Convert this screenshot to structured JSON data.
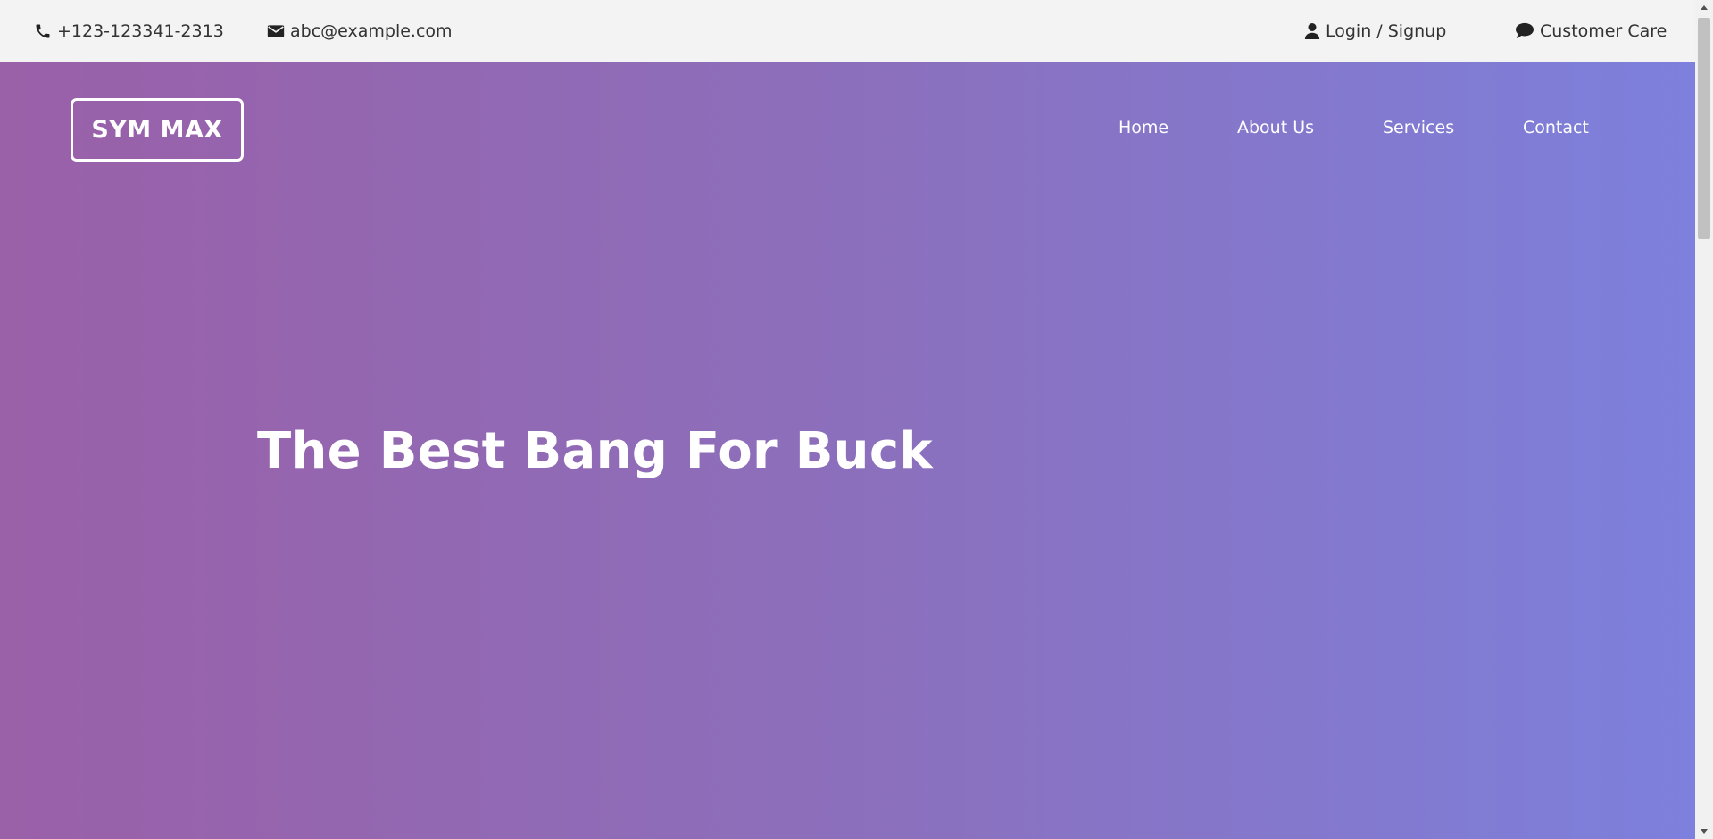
{
  "topbar": {
    "phone": {
      "icon": "phone-icon",
      "text": "+123-123341-2313"
    },
    "email": {
      "icon": "envelope-icon",
      "text": "abc@example.com"
    },
    "login": {
      "icon": "user-icon",
      "text": "Login / Signup"
    },
    "care": {
      "icon": "chat-bubble-icon",
      "text": "Customer Care"
    }
  },
  "brand": {
    "text": "SYM MAX"
  },
  "nav": {
    "items": [
      {
        "label": "Home"
      },
      {
        "label": "About Us"
      },
      {
        "label": "Services"
      },
      {
        "label": "Contact"
      }
    ]
  },
  "hero": {
    "headline": "The Best Bang For Buck",
    "gradient_start": "#9a60a8",
    "gradient_end": "#7d80dc"
  },
  "colors": {
    "topbar_bg": "#f3f3f3",
    "topbar_text": "#333333",
    "hero_text": "#ffffff"
  }
}
